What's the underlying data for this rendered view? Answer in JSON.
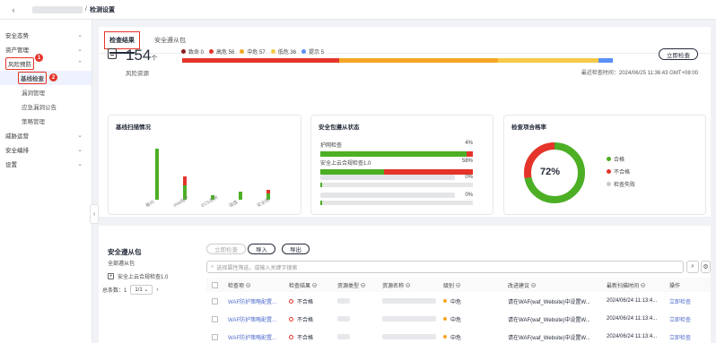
{
  "breadcrumb": {
    "separator": "/",
    "current": "检测设置"
  },
  "sidebar": {
    "items": [
      {
        "label": "安全态势"
      },
      {
        "label": "资产管理"
      },
      {
        "label": "风险预防"
      },
      {
        "label": "威胁运营"
      },
      {
        "label": "安全编排"
      },
      {
        "label": "设置"
      }
    ],
    "sub_items": [
      {
        "label": "基线检查"
      },
      {
        "label": "漏洞管理"
      },
      {
        "label": "应急漏洞公告"
      },
      {
        "label": "策略管理"
      }
    ],
    "badges": [
      "1",
      "2"
    ]
  },
  "tabs": [
    {
      "label": "检查结果"
    },
    {
      "label": "安全遵从包"
    }
  ],
  "risk": {
    "count": "154",
    "unit": "个",
    "label": "风险资源",
    "legend": [
      {
        "label": "致命 0",
        "color": "#8a1f1f",
        "value": 0
      },
      {
        "label": "高危 56",
        "color": "#e5342a",
        "value": 56
      },
      {
        "label": "中危 57",
        "color": "#f5a623",
        "value": 57
      },
      {
        "label": "低危 36",
        "color": "#f7c948",
        "value": 36
      },
      {
        "label": "提示 5",
        "color": "#5b8ff9",
        "value": 5
      }
    ],
    "check_button": "立即检查",
    "last_check": "最近检查时间：2024/06/25 11:36:43 GMT+08:00"
  },
  "cards": {
    "scan": {
      "title": "基线扫描情况",
      "bar_labels": [
        "着问",
        "IAM用户",
        "ECS实例",
        "磁盘",
        "安全组"
      ]
    },
    "compliance": {
      "title": "安全包遵从状态",
      "rows": [
        {
          "label": "护网检查",
          "pct": "4%"
        },
        {
          "label": "安全上云合规检查1.0",
          "pct": "58%"
        },
        {
          "label": "",
          "pct": "0%"
        },
        {
          "label": "",
          "pct": "0%"
        }
      ]
    },
    "pass_rate": {
      "title": "检查项合格率",
      "value": "72%",
      "legend": [
        {
          "label": "合格",
          "color": "#4caf24"
        },
        {
          "label": "不合格",
          "color": "#e5342a"
        },
        {
          "label": "检查失败",
          "color": "#c7cbd1"
        }
      ]
    }
  },
  "chart_data": {
    "type": "bar",
    "title": "基线扫描情况",
    "categories": [
      "着问",
      "IAM用户",
      "ECS实例",
      "磁盘",
      "安全组"
    ],
    "series": [
      {
        "name": "合格",
        "color": "#4caf24",
        "values": [
          62,
          18,
          6,
          10,
          8
        ]
      },
      {
        "name": "不合格",
        "color": "#e5342a",
        "values": [
          0,
          10,
          0,
          0,
          4
        ]
      }
    ],
    "ylim": [
      0,
      70
    ]
  },
  "package": {
    "title": "安全遵从包",
    "subtitle": "全部遵从包",
    "item": "安全上云合规检查1.0",
    "total": "总条数：1",
    "page": "1/1"
  },
  "table": {
    "buttons": {
      "check": "立即检查",
      "import": "导入",
      "export": "导出"
    },
    "search_placeholder": "选择属性筛选，或输入关键字搜索",
    "headers": [
      "检查项 ⊖",
      "检查结果 ⊖",
      "资源类型 ⊖",
      "资源名称 ⊖",
      "级别 ⊖",
      "改进建议 ⊖",
      "最新扫描时间 ⊖",
      "操作"
    ],
    "rows": [
      {
        "item": "WAF防护策略配置...",
        "result": "不合格",
        "level": "中危",
        "advice": "请在WAF(waf_Website)中设置W...",
        "time": "2024/06/24 11:13:4...",
        "action": "立即检查"
      },
      {
        "item": "WAF防护策略配置...",
        "result": "不合格",
        "level": "中危",
        "advice": "请在WAF(waf_Website)中设置W...",
        "time": "2024/06/24 11:13:4...",
        "action": "立即检查"
      },
      {
        "item": "WAF防护策略配置...",
        "result": "不合格",
        "level": "中危",
        "advice": "请在WAF(waf_Website)中设置W...",
        "time": "2024/06/24 11:13:4...",
        "action": "立即检查"
      }
    ]
  }
}
